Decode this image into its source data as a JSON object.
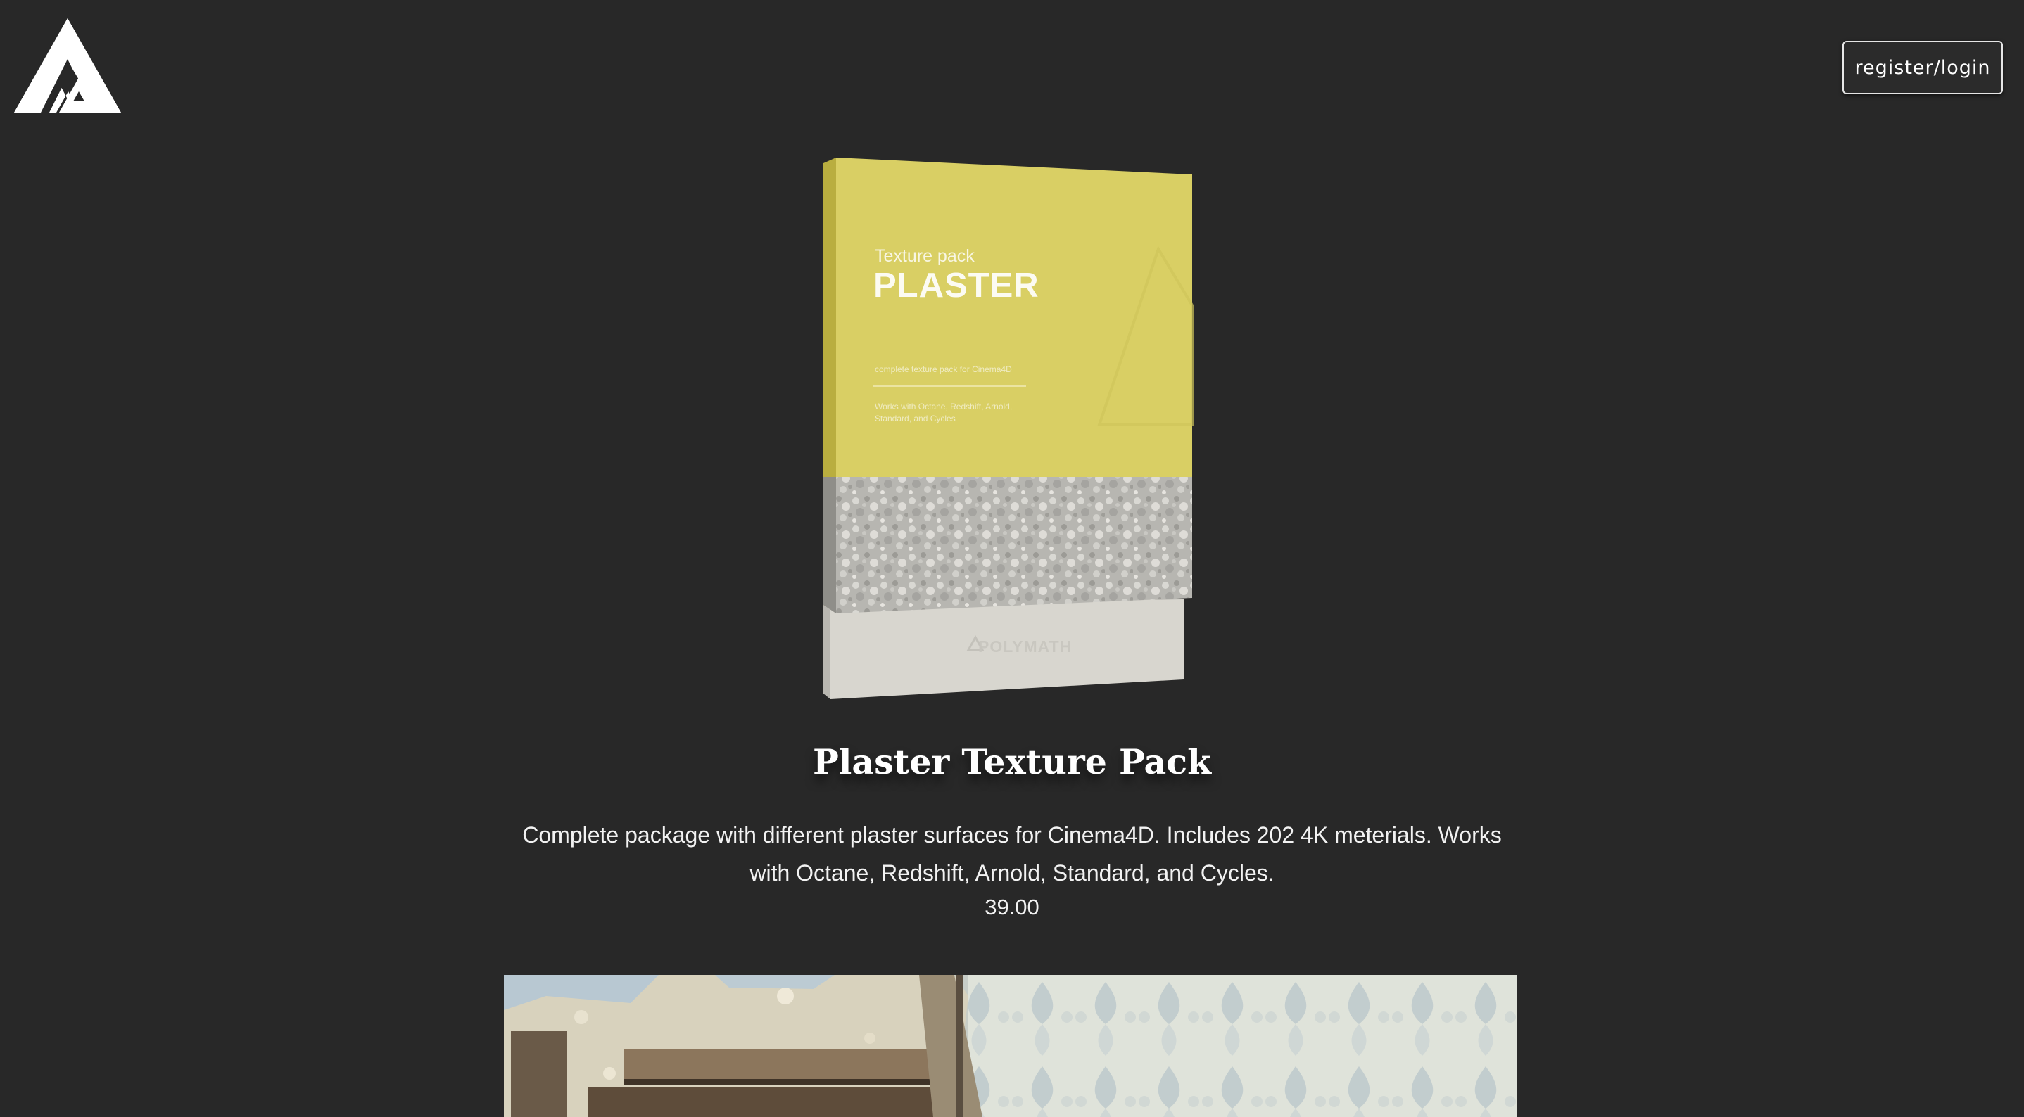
{
  "header": {
    "logo_icon": "polymath-triangle-logo",
    "auth_button_label": "register/login"
  },
  "product": {
    "box": {
      "subtitle": "Texture pack",
      "title": "PLASTER",
      "tagline": "complete texture pack for Cinema4D",
      "compat": "Works with Octane, Redshift, Arnold, Standard, and Cycles",
      "brand": "POLYMATH",
      "color": "#d9cf64"
    },
    "title": "Plaster Texture Pack",
    "description": "Complete package with different plaster surfaces for Cinema4D. Includes 202 4K meterials. Works with Octane, Redshift, Arnold, Standard, and Cycles.",
    "price": "39.00"
  },
  "colors": {
    "background": "#282828",
    "text": "#ffffff",
    "box_yellow": "#d9cf64",
    "box_base": "#d8d6cf"
  }
}
